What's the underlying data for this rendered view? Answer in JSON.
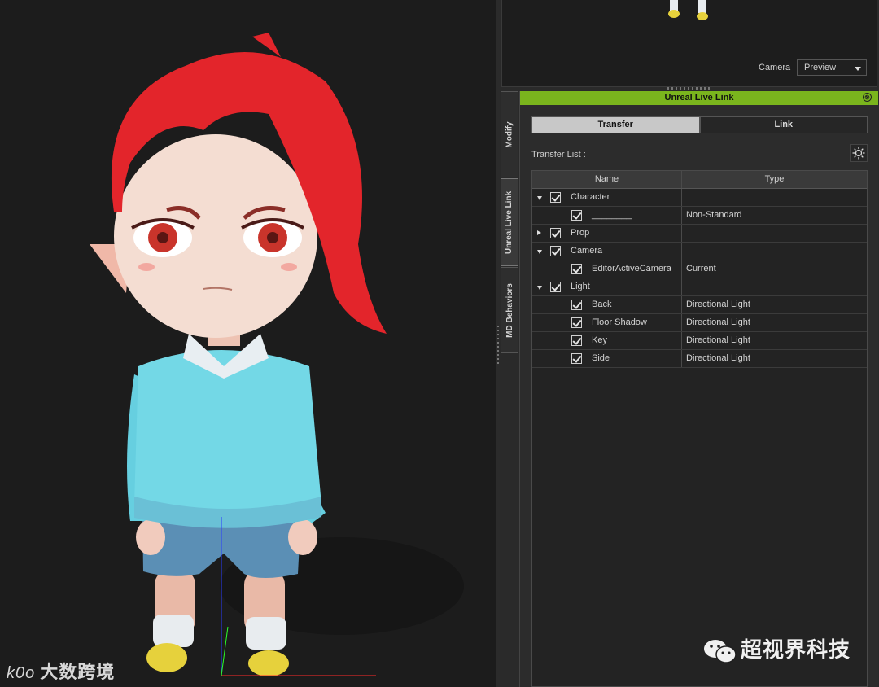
{
  "preview": {
    "camera_label": "Camera",
    "camera_value": "Preview"
  },
  "side_tabs": [
    {
      "label": "Modify"
    },
    {
      "label": "Unreal Live Link"
    },
    {
      "label": "MD Behaviors"
    }
  ],
  "panel": {
    "title": "Unreal Live Link",
    "close_glyph": "⊗",
    "tabs": [
      {
        "label": "Transfer",
        "active": true
      },
      {
        "label": "Link",
        "active": false
      }
    ],
    "transfer_list_label": "Transfer List :",
    "settings_icon": "gear-icon",
    "accent_color": "#7ab51d"
  },
  "table": {
    "columns": [
      "Name",
      "Type"
    ],
    "rows": [
      {
        "name": "Character",
        "type": "",
        "level": 0,
        "expander": "open",
        "checked": true
      },
      {
        "name": "________",
        "type": "Non-Standard",
        "level": 1,
        "expander": "",
        "checked": true
      },
      {
        "name": "Prop",
        "type": "",
        "level": 0,
        "expander": "closed",
        "checked": true
      },
      {
        "name": "Camera",
        "type": "",
        "level": 0,
        "expander": "open",
        "checked": true
      },
      {
        "name": "EditorActiveCamera",
        "type": "Current",
        "level": 1,
        "expander": "",
        "checked": true
      },
      {
        "name": "Light",
        "type": "",
        "level": 0,
        "expander": "open",
        "checked": true
      },
      {
        "name": "Back",
        "type": "Directional Light",
        "level": 1,
        "expander": "",
        "checked": true
      },
      {
        "name": "Floor Shadow",
        "type": "Directional Light",
        "level": 1,
        "expander": "",
        "checked": true
      },
      {
        "name": "Key",
        "type": "Directional Light",
        "level": 1,
        "expander": "",
        "checked": true
      },
      {
        "name": "Side",
        "type": "Directional Light",
        "level": 1,
        "expander": "",
        "checked": true
      }
    ]
  },
  "watermarks": {
    "left": "大数跨境",
    "left_logo": "k0o",
    "right": "超视界科技",
    "right_icon": "wechat-icon"
  }
}
